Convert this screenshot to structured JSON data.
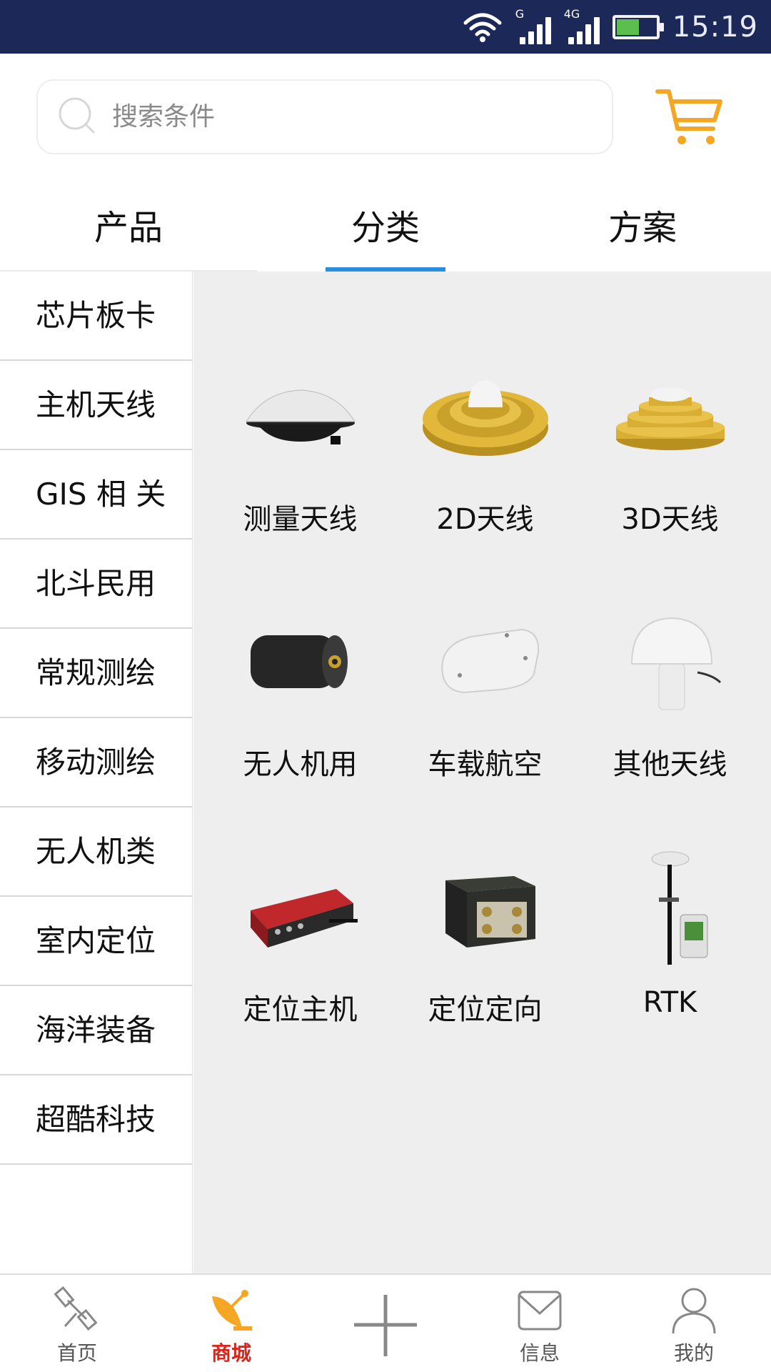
{
  "status_bar": {
    "time": "15:19",
    "signal1_label": "G",
    "signal2_label": "4G",
    "battery_level": 0.56
  },
  "search": {
    "placeholder": "搜索条件"
  },
  "tabs": [
    {
      "label": "产品",
      "active": false
    },
    {
      "label": "分类",
      "active": true
    },
    {
      "label": "方案",
      "active": false
    }
  ],
  "sidebar": {
    "items": [
      {
        "label": "芯片板卡"
      },
      {
        "label": "主机天线"
      },
      {
        "label": "GIS 相 关"
      },
      {
        "label": "北斗民用"
      },
      {
        "label": "常规测绘"
      },
      {
        "label": "移动测绘"
      },
      {
        "label": "无人机类"
      },
      {
        "label": "室内定位"
      },
      {
        "label": "海洋装备"
      },
      {
        "label": "超酷科技"
      }
    ]
  },
  "categories": [
    {
      "label": "测量天线",
      "icon": "survey-antenna-icon"
    },
    {
      "label": "2D天线",
      "icon": "2d-antenna-icon"
    },
    {
      "label": "3D天线",
      "icon": "3d-antenna-icon"
    },
    {
      "label": "无人机用",
      "icon": "drone-antenna-icon"
    },
    {
      "label": "车载航空",
      "icon": "vehicle-antenna-icon"
    },
    {
      "label": "其他天线",
      "icon": "other-antenna-icon"
    },
    {
      "label": "定位主机",
      "icon": "positioning-receiver-icon"
    },
    {
      "label": "定位定向",
      "icon": "orientation-receiver-icon"
    },
    {
      "label": "RTK",
      "icon": "rtk-icon"
    }
  ],
  "bottom_nav": [
    {
      "label": "首页",
      "icon": "satellite-icon",
      "active": false
    },
    {
      "label": "商城",
      "icon": "dish-icon",
      "active": true
    },
    {
      "label": "",
      "icon": "plus-icon",
      "active": false
    },
    {
      "label": "信息",
      "icon": "mail-icon",
      "active": false
    },
    {
      "label": "我的",
      "icon": "user-icon",
      "active": false
    }
  ],
  "colors": {
    "status_bar": "#1c2857",
    "tab_indicator": "#2b8fe0",
    "cart": "#f5a623",
    "active_nav": "#d9251b",
    "content_bg": "#eeeeee"
  }
}
